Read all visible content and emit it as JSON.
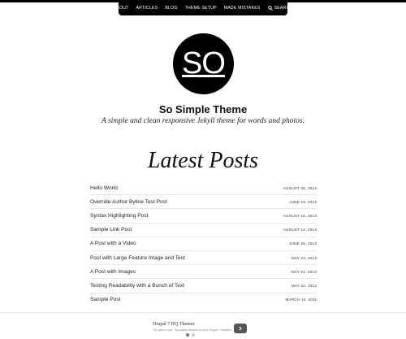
{
  "nav": {
    "items": [
      {
        "label": "ABOUT"
      },
      {
        "label": "ARTICLES"
      },
      {
        "label": "BLOG"
      },
      {
        "label": "THEME SETUP"
      },
      {
        "label": "MADE MISTAKES"
      }
    ],
    "search_label": "SEARCH",
    "search_icon": "search-icon"
  },
  "logo": {
    "text": "SO"
  },
  "site": {
    "title": "So Simple Theme",
    "description": "A simple and clean responsive Jekyll theme for words and photos."
  },
  "section_title": "Latest Posts",
  "posts": [
    {
      "title": "Hello World",
      "date": "AUGUST 06, 2014"
    },
    {
      "title": "Override Author Byline Test Post",
      "date": "JUNE 19, 2014"
    },
    {
      "title": "Syntax Highlighting Post",
      "date": "AUGUST 16, 2013"
    },
    {
      "title": "Sample Link Post",
      "date": "AUGUST 12, 2013"
    },
    {
      "title": "A Post with a Video",
      "date": "JUNE 25, 2013"
    },
    {
      "title": "Post with Large Feature Image and Text",
      "date": "MAY 23, 2013"
    },
    {
      "title": "A Post with Images",
      "date": "MAY 22, 2013"
    },
    {
      "title": "Testing Readability with a Bunch of Text",
      "date": "MAY 22, 2012"
    },
    {
      "title": "Sample Post",
      "date": "MARCH 10, 2011"
    }
  ],
  "ad": {
    "title": "Drupal 7 HQ Themes",
    "subtitle": "The wait is over. Top quality themes for your Drupal 7 websites.",
    "button_icon": "chevron-right-icon"
  },
  "colors": {
    "nav_bg": "#000000",
    "logo_bg": "#000000",
    "text": "#222222"
  }
}
